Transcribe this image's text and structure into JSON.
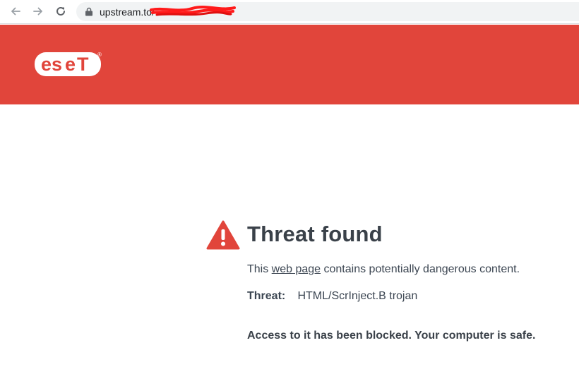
{
  "browser": {
    "url_visible": "upstream.to/"
  },
  "brand": {
    "logo_text": "eset",
    "registered_mark": "®",
    "accent_color": "#e1453b"
  },
  "alert": {
    "title": "Threat found",
    "desc_prefix": "This ",
    "desc_link": "web page",
    "desc_suffix": " contains potentially dangerous content.",
    "threat_label": "Threat:",
    "threat_value": "HTML/ScrInject.B trojan",
    "blocked_message": "Access to it has been blocked. Your computer is safe."
  },
  "icons": {
    "back": "arrow-left-icon",
    "forward": "arrow-right-icon",
    "reload": "reload-icon",
    "lock": "lock-icon",
    "warning": "warning-triangle-icon"
  }
}
